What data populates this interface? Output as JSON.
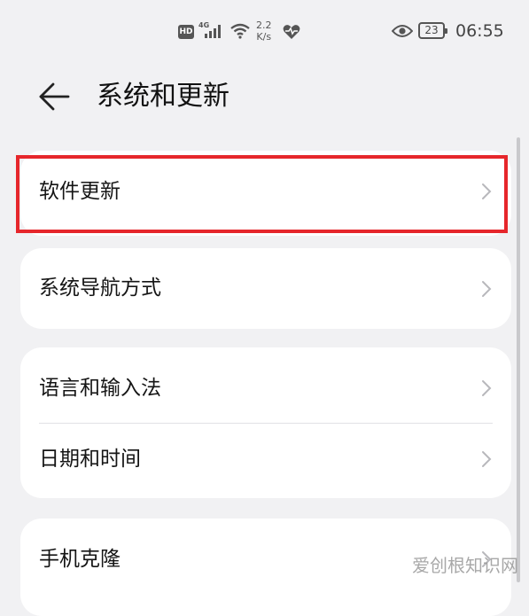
{
  "status_bar": {
    "hd_label": "HD",
    "network_label": "4G",
    "speed_value": "2.2",
    "speed_unit": "K/s",
    "battery_level": "23",
    "time": "06:55",
    "icons": [
      "hd-icon",
      "signal-icon",
      "wifi-icon",
      "heart-rate-icon",
      "eye-icon",
      "battery-icon"
    ]
  },
  "header": {
    "back_icon": "arrow-left-icon",
    "title": "系统和更新"
  },
  "groups": [
    {
      "items": [
        {
          "label": "软件更新"
        }
      ]
    },
    {
      "items": [
        {
          "label": "系统导航方式"
        }
      ]
    },
    {
      "items": [
        {
          "label": "语言和输入法"
        },
        {
          "label": "日期和时间"
        }
      ]
    },
    {
      "items": [
        {
          "label": "手机克隆"
        }
      ]
    }
  ],
  "highlight": {
    "color": "#e6262b",
    "target": "软件更新"
  },
  "watermark": "爱创根知识网",
  "colors": {
    "background": "#f1f1f3",
    "card": "#ffffff",
    "chevron": "#b8b8bc"
  }
}
